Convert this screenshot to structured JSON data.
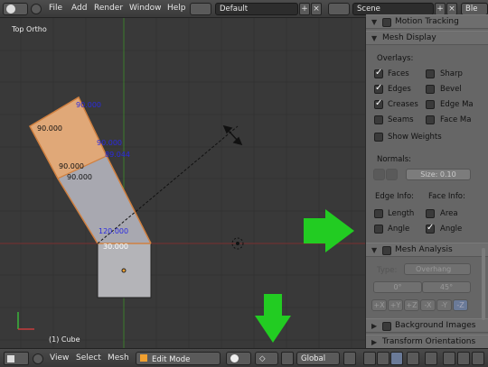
{
  "topbar": {
    "menus": [
      "File",
      "Add",
      "Render",
      "Window",
      "Help"
    ],
    "screen_layout": "Default",
    "scene": "Scene",
    "engine": "Ble"
  },
  "viewport": {
    "view_label": "Top Ortho",
    "object_label": "(1) Cube",
    "angle_labels": [
      "90.000",
      "90.000",
      "90.000",
      "90.000",
      "89.044",
      "120.000",
      "30.000",
      "90.000"
    ]
  },
  "panel": {
    "motion_tracking": "Motion Tracking",
    "mesh_display": "Mesh Display",
    "overlays_label": "Overlays:",
    "overlays": [
      {
        "label": "Faces",
        "checked": true
      },
      {
        "label": "Sharp",
        "checked": false
      },
      {
        "label": "Edges",
        "checked": true
      },
      {
        "label": "Bevel",
        "checked": false
      },
      {
        "label": "Creases",
        "checked": true
      },
      {
        "label": "Edge Ma",
        "checked": false
      },
      {
        "label": "Seams",
        "checked": false
      },
      {
        "label": "Face Ma",
        "checked": false
      }
    ],
    "show_weights": "Show Weights",
    "normals_label": "Normals:",
    "normal_size": "Size: 0.10",
    "edge_info_label": "Edge Info:",
    "face_info_label": "Face Info:",
    "edge_info": [
      {
        "label": "Length",
        "checked": false
      },
      {
        "label": "Angle",
        "checked": false
      }
    ],
    "face_info": [
      {
        "label": "Area",
        "checked": false
      },
      {
        "label": "Angle",
        "checked": true
      }
    ],
    "mesh_analysis": "Mesh Analysis",
    "type_label": "Type:",
    "type_value": "Overhang",
    "angle_min": "0°",
    "angle_max": "45°",
    "axes": [
      "+X",
      "+Y",
      "+Z",
      "-X",
      "-Y",
      "-Z"
    ],
    "background_images": "Background Images",
    "transform_orientations": "Transform Orientations"
  },
  "bottombar": {
    "menus": [
      "View",
      "Select",
      "Mesh"
    ],
    "mode": "Edit Mode",
    "orientation": "Global"
  },
  "colors": {
    "arrow": "#22cc22",
    "face_selected": "#e0a878",
    "face_grey": "#a8a8b0"
  }
}
